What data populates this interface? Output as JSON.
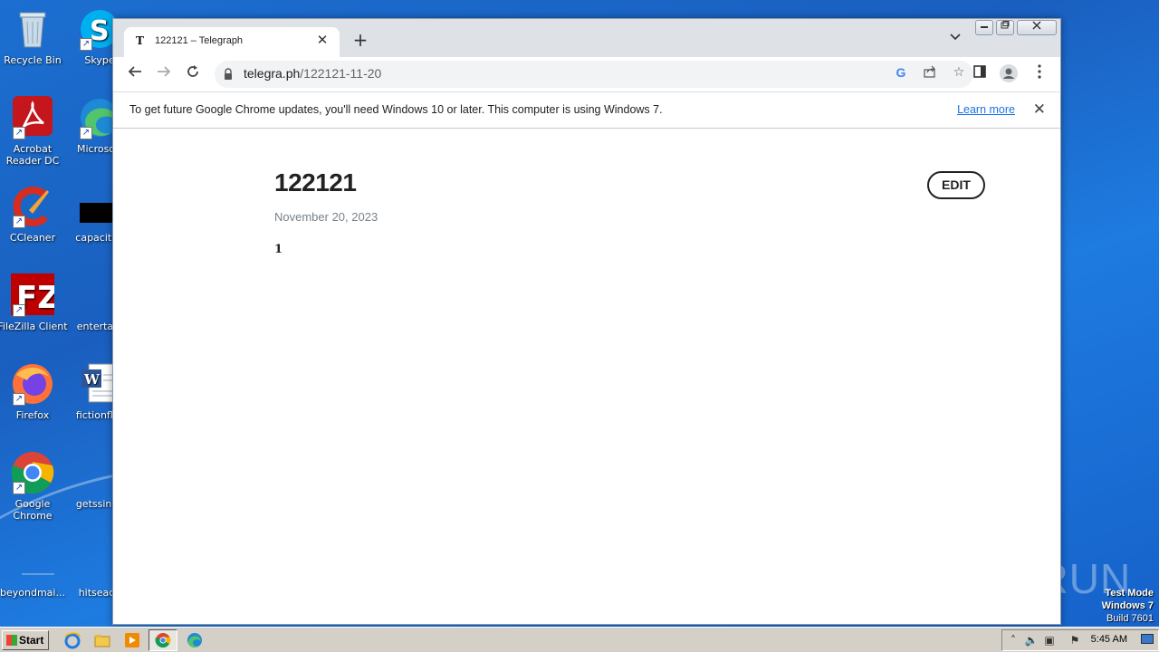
{
  "desktop": {
    "icons": [
      {
        "label": "Recycle Bin"
      },
      {
        "label": "Skype"
      },
      {
        "label": "Acrobat Reader DC"
      },
      {
        "label": "Microsoft"
      },
      {
        "label": "CCleaner"
      },
      {
        "label": "capacityb"
      },
      {
        "label": "FileZilla Client"
      },
      {
        "label": "entertain"
      },
      {
        "label": "Firefox"
      },
      {
        "label": "fictionflor"
      },
      {
        "label": "Google Chrome"
      },
      {
        "label": "getssince"
      },
      {
        "label": "beyondmai..."
      },
      {
        "label": "hitseach"
      }
    ],
    "watermark": "ANY RUN",
    "test_mode": {
      "line1": "Test Mode",
      "line2": "Windows 7",
      "line3": "Build 7601"
    }
  },
  "browser": {
    "tab": {
      "favicon": "T",
      "title": "122121 – Telegraph",
      "close": "✕"
    },
    "new_tab": "+",
    "address": {
      "host": "telegra.ph",
      "path": "/122121-11-20"
    },
    "infobar": {
      "message": "To get future Google Chrome updates, you'll need Windows 10 or later. This computer is using Windows 7.",
      "link": "Learn more",
      "close": "✕"
    }
  },
  "page": {
    "title": "122121",
    "date": "November 20, 2023",
    "body": "1",
    "edit_label": "EDIT"
  },
  "taskbar": {
    "start_label": "Start",
    "clock": "5:45 AM"
  }
}
